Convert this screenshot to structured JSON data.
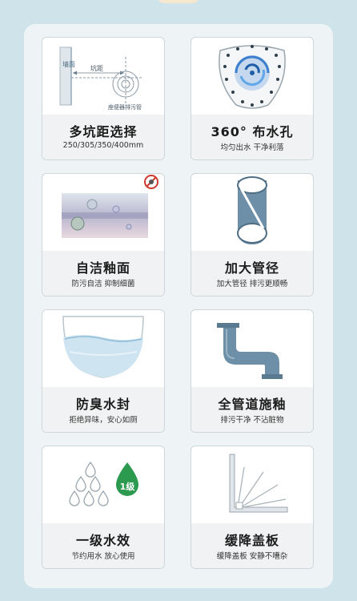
{
  "features": [
    {
      "title": "多坑距选择",
      "subtitle": "250/305/350/400mm",
      "icon": "pit-distance-diagram-icon",
      "diagram": {
        "wall_label": "墙面",
        "pit_label": "坑距",
        "outlet_label": "座便器排污管"
      }
    },
    {
      "title": "360° 布水孔",
      "subtitle": "均匀出水 干净利落",
      "icon": "water-holes-icon"
    },
    {
      "title": "自洁釉面",
      "subtitle": "防污自洁 抑制细菌",
      "icon": "glaze-surface-icon"
    },
    {
      "title": "加大管径",
      "subtitle": "加大管径 排污更顺畅",
      "icon": "large-pipe-icon"
    },
    {
      "title": "防臭水封",
      "subtitle": "拒绝异味，安心如厕",
      "icon": "water-seal-icon"
    },
    {
      "title": "全管道施釉",
      "subtitle": "排污干净 不沾脏物",
      "icon": "glazed-pipe-icon"
    },
    {
      "title": "一级水效",
      "subtitle": "节约用水 放心使用",
      "icon": "water-drops-icon",
      "badge": "1级"
    },
    {
      "title": "缓降盖板",
      "subtitle": "缓降盖板 安静不嘈杂",
      "icon": "soft-close-lid-icon"
    }
  ],
  "colors": {
    "pipe": "#6d8fa8",
    "badge": "#2c9a4e",
    "accent_blue": "#3b7fcf"
  }
}
